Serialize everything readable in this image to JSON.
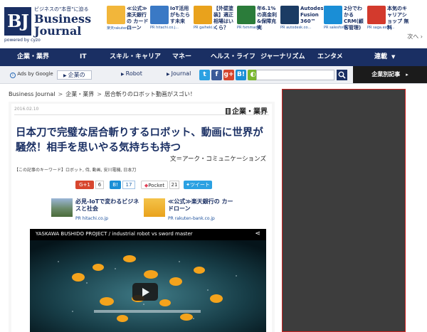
{
  "header": {
    "logo": {
      "mark": "BJ",
      "tagline": "ビジネスの\"本音\"に迫る",
      "name_line1": "Business",
      "name_line2": "Journal",
      "powered_by": "powered by cyzo"
    },
    "ads": [
      {
        "text": "≪公式≫楽天銀行の カードローン",
        "source": "楽天rakuten.b...",
        "color": "#f2b63a"
      },
      {
        "text": "IoT活用がもたらす未来",
        "source": "PR hitachi.co.j...",
        "color": "#3a79c5"
      },
      {
        "text": "【外壁塗装】適正相場はいくら？",
        "source": "PR gaiheki.y...",
        "color": "#e9a21c"
      },
      {
        "text": "年6.1%の高金利&保障充実",
        "source": "PR fxmmade...",
        "color": "#2b7c3a"
      },
      {
        "text": "Autodesk® Fusion 360™",
        "source": "PR autodesk.co...",
        "color": "#1b3c64"
      },
      {
        "text": "2分でわかるCRM(顧客管理)",
        "source": "PR salesforce...",
        "color": "#1a8ed6"
      },
      {
        "text": "本気のキャリアショップ 無料",
        "source": "PR saga.estor...",
        "color": "#d33a2d"
      }
    ],
    "next_label": "次へ ›"
  },
  "nav": {
    "items": [
      "企業・業界",
      "IT",
      "スキル・キャリア",
      "マネー",
      "ヘルス・ライフ",
      "ジャーナリズム",
      "エンタメ",
      "連載"
    ]
  },
  "subbar": {
    "ads_by": "Ads by Google",
    "links": [
      "企業の",
      "Robot",
      "Journal"
    ],
    "social_icons": [
      {
        "name": "twitter-icon",
        "glyph": "t",
        "color": "#2ba1e2"
      },
      {
        "name": "facebook-icon",
        "glyph": "f",
        "color": "#3b5a98"
      },
      {
        "name": "google-plus-icon",
        "glyph": "g+",
        "color": "#d7462e"
      },
      {
        "name": "hatena-icon",
        "glyph": "B!",
        "color": "#1b8fd6"
      },
      {
        "name": "rss-icon",
        "glyph": "◐",
        "color": "#79b62f"
      }
    ],
    "search_placeholder": "",
    "corp_articles_label": "企業別記事"
  },
  "breadcrumb": [
    "Business Journal",
    "企業・業界",
    "居合斬りのロボット動画がスゴい！"
  ],
  "article": {
    "date": "2016.02.10",
    "category": "企業・業界",
    "title": "日本刀で完璧な居合斬りするロボット、動画に世界が騒然！相手を思いやる気持ちも持つ",
    "author": "文＝アーク・コミュニケーションズ",
    "keywords": "【この記事のキーワード】ロボット, 侍, 動画, 安川電機, 日本刀",
    "share": {
      "gplus_label": "G+1",
      "gplus_count": "6",
      "hatena_label": "B!",
      "hatena_count": "17",
      "pocket_label": "Pocket",
      "pocket_count": "21",
      "tweet_label": "ツイート"
    },
    "inner_ads": [
      {
        "text": "必見-IoTで変わるビジネスと社会",
        "source": "PR hitachi.co.jp"
      },
      {
        "text": "≪公式≫楽天銀行の カードローン",
        "source": "PR rakuten-bank.co.jp"
      }
    ],
    "video": {
      "title": "YASKAWA BUSHIDO PROJECT / industrial robot vs sword master"
    }
  }
}
